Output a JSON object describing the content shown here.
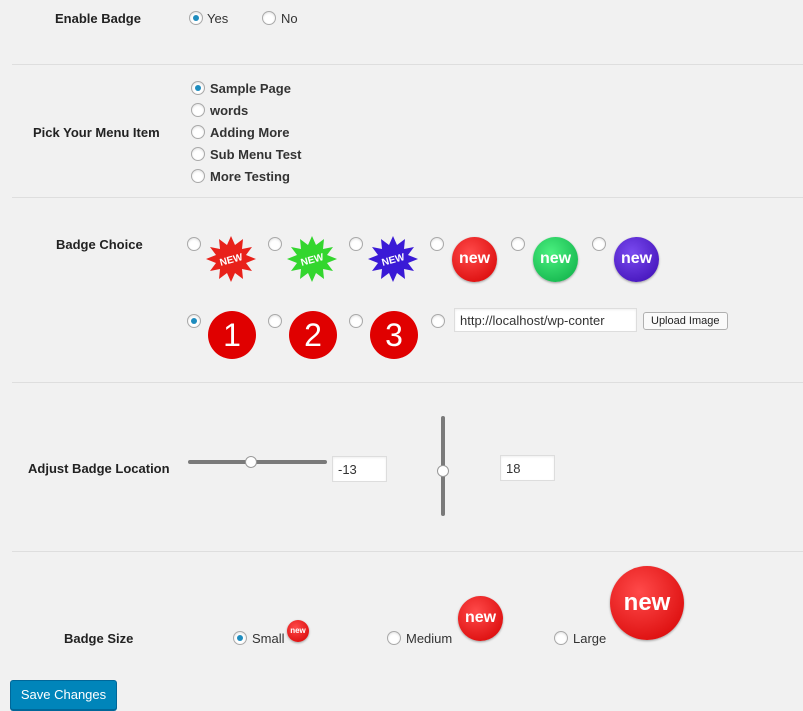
{
  "enable_badge": {
    "label": "Enable Badge",
    "options": [
      {
        "label": "Yes",
        "checked": true
      },
      {
        "label": "No",
        "checked": false
      }
    ]
  },
  "menu_item": {
    "label": "Pick Your Menu Item",
    "options": [
      {
        "label": "Sample Page",
        "checked": true
      },
      {
        "label": "words",
        "checked": false
      },
      {
        "label": "Adding More",
        "checked": false
      },
      {
        "label": "Sub Menu Test",
        "checked": false
      },
      {
        "label": "More Testing",
        "checked": false
      }
    ]
  },
  "badge_choice": {
    "label": "Badge Choice",
    "starbursts": [
      {
        "text": "NEW",
        "color": "#e8211a",
        "checked": false
      },
      {
        "text": "NEW",
        "color": "#33d62e",
        "checked": false
      },
      {
        "text": "NEW",
        "color": "#3a1ad6",
        "checked": false
      }
    ],
    "circles": [
      {
        "text": "new",
        "color": "#e3141b",
        "checked": false
      },
      {
        "text": "new",
        "color": "#18c857",
        "checked": false
      },
      {
        "text": "new",
        "color": "#4a12c8",
        "checked": false
      }
    ],
    "numbers": [
      {
        "text": "1",
        "checked": true
      },
      {
        "text": "2",
        "checked": false
      },
      {
        "text": "3",
        "checked": false
      }
    ],
    "custom": {
      "checked": false,
      "url_value": "http://localhost/wp-conter",
      "upload_label": "Upload Image"
    }
  },
  "badge_location": {
    "label": "Adjust Badge Location",
    "horizontal_value": "-13",
    "vertical_value": "18"
  },
  "badge_size": {
    "label": "Badge Size",
    "options": [
      {
        "label": "Small",
        "checked": true,
        "badge_text": "new"
      },
      {
        "label": "Medium",
        "checked": false,
        "badge_text": "new"
      },
      {
        "label": "Large",
        "checked": false,
        "badge_text": "new"
      }
    ]
  },
  "save_label": "Save Changes",
  "colors": {
    "accent": "#1e8cbe",
    "button": "#0085ba",
    "badge_red": "#e00000"
  }
}
